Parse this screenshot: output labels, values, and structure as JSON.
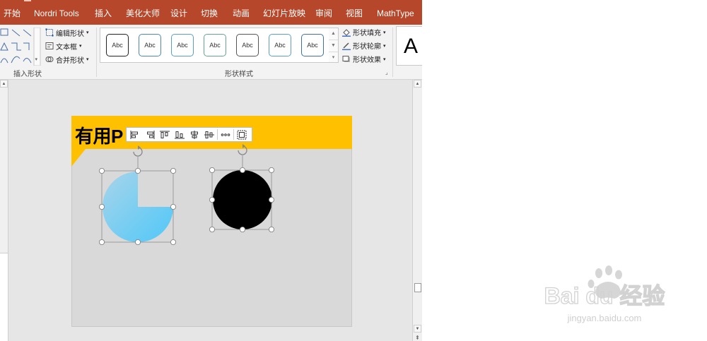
{
  "ribbon_tabs": [
    "开始",
    "Nordri Tools",
    "插入",
    "美化大师",
    "设计",
    "切换",
    "动画",
    "幻灯片放映",
    "审阅",
    "视图",
    "MathType"
  ],
  "insert_shapes_group": {
    "label": "插入形状",
    "commands": [
      "编辑形状",
      "文本框",
      "合并形状"
    ]
  },
  "shape_styles_group": {
    "label": "形状样式",
    "thumbnails": [
      {
        "text": "Abc",
        "border": "#222222"
      },
      {
        "text": "Abc",
        "border": "#4a88b8"
      },
      {
        "text": "Abc",
        "border": "#5a9ec9"
      },
      {
        "text": "Abc",
        "border": "#63a58a"
      },
      {
        "text": "Abc",
        "border": "#555555"
      },
      {
        "text": "Abc",
        "border": "#5a9ec9"
      },
      {
        "text": "Abc",
        "border": "#3f6fa8"
      }
    ],
    "format_commands": [
      "形状填充",
      "形状轮廓",
      "形状效果"
    ]
  },
  "wordart_preview": "A",
  "slide": {
    "title": "有用P",
    "banner_color": "#ffc000",
    "shape1": {
      "name": "pie",
      "fill_start": "#a8d4ea",
      "fill_end": "#50c8f8"
    },
    "shape2": {
      "name": "circle",
      "fill": "#000000"
    }
  },
  "watermark": {
    "brand": "Bai du 经验",
    "url": "jingyan.baidu.com"
  },
  "colors": {
    "tab_bar": "#b7472a",
    "ribbon": "#f3f3f3",
    "canvas": "#e6e6e6"
  }
}
